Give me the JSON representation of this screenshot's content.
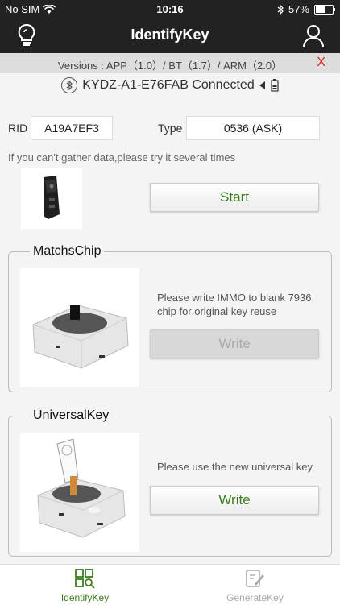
{
  "status": {
    "carrier": "No SIM",
    "time": "10:16",
    "battery": "57%",
    "battery_level": 0.57
  },
  "nav": {
    "title": "IdentifyKey"
  },
  "versions": {
    "text": "Versions : APP（1.0）/ BT（1.7）/ ARM（2.0）",
    "close": "X"
  },
  "connection": {
    "text": "KYDZ-A1-E76FAB Connected"
  },
  "fields": {
    "rid_label": "RID",
    "rid_value": "A19A7EF3",
    "type_label": "Type",
    "type_value": "0536 (ASK)"
  },
  "hint": "If you can't gather data,please try it several times",
  "start_button": "Start",
  "matchs_chip": {
    "title": "MatchsChip",
    "text": "Please write IMMO to blank 7936 chip for original key reuse",
    "button": "Write"
  },
  "universal_key": {
    "title": "UniversalKey",
    "text": "Please use the new universal key",
    "button": "Write"
  },
  "tabs": [
    {
      "label": "IdentifyKey",
      "active": true
    },
    {
      "label": "GenerateKey",
      "active": false
    }
  ],
  "colors": {
    "accent": "#3a7d1e",
    "close": "#e02020",
    "bar": "#222222"
  }
}
